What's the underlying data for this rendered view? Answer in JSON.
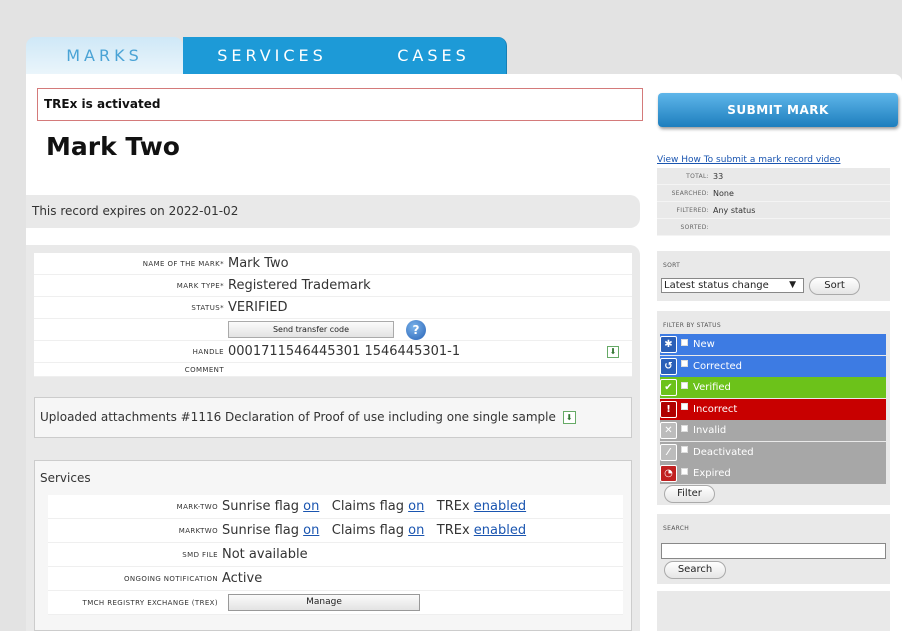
{
  "tabs": {
    "marks": "MARKS",
    "services": "SERVICES",
    "cases": "CASES"
  },
  "alert": "TREx is activated",
  "title": "Mark Two",
  "expires": "This record expires on 2022-01-02",
  "fields": {
    "name_label": "Name of the mark*",
    "name_value": "Mark Two",
    "type_label": "Mark type*",
    "type_value": "Registered Trademark",
    "status_label": "Status*",
    "status_value": "VERIFIED",
    "transfer_button": "Send transfer code",
    "help_glyph": "?",
    "handle_label": "Handle",
    "handle_value": "0001711546445301 1546445301-1",
    "comment_label": "Comment",
    "comment_value": ""
  },
  "attachments": "Uploaded attachments #1116 Declaration of Proof of use including one single sample",
  "services": {
    "title": "Services",
    "rows": [
      {
        "label": "mark-two",
        "sunrise": "Sunrise flag",
        "sunrise_link": "on",
        "claims": "Claims flag",
        "claims_link": "on",
        "trex": "TREx",
        "trex_link": "enabled"
      },
      {
        "label": "marktwo",
        "sunrise": "Sunrise flag",
        "sunrise_link": "on",
        "claims": "Claims flag",
        "claims_link": "on",
        "trex": "TREx",
        "trex_link": "enabled"
      }
    ],
    "smd_label": "SMD file",
    "smd_value": "Not available",
    "notif_label": "Ongoing notification",
    "notif_value": "Active",
    "trex_label": "TMCH Registry Exchange (TREx)",
    "manage_button": "Manage"
  },
  "sidebar": {
    "submit": "SUBMIT MARK",
    "video_link": "View How To submit a mark record video",
    "stats": [
      {
        "label": "Total:",
        "value": "33"
      },
      {
        "label": "Searched:",
        "value": "None"
      },
      {
        "label": "Filtered:",
        "value": "Any status"
      },
      {
        "label": "Sorted:",
        "value": ""
      }
    ],
    "sort_title": "Sort",
    "sort_selected": "Latest status change",
    "sort_button": "Sort",
    "filter_title": "Filter by status",
    "filters": [
      {
        "label": "New",
        "bg": "#3d7be3",
        "icon_bg": "#2a5fb8",
        "glyph": "✱"
      },
      {
        "label": "Corrected",
        "bg": "#3d7be3",
        "icon_bg": "#2a5fb8",
        "glyph": "↺"
      },
      {
        "label": "Verified",
        "bg": "#6cc21a",
        "icon_bg": "#6cc21a",
        "glyph": "✔"
      },
      {
        "label": "Incorrect",
        "bg": "#c80000",
        "icon_bg": "#b00000",
        "glyph": "!"
      },
      {
        "label": "Invalid",
        "bg": "#a7a7a7",
        "icon_bg": "#bcbcbc",
        "glyph": "✕"
      },
      {
        "label": "Deactivated",
        "bg": "#a7a7a7",
        "icon_bg": "#bcbcbc",
        "glyph": "⁄"
      },
      {
        "label": "Expired",
        "bg": "#a7a7a7",
        "icon_bg": "#c02020",
        "glyph": "◔"
      }
    ],
    "filter_button": "Filter",
    "search_title": "Search",
    "search_button": "Search"
  }
}
